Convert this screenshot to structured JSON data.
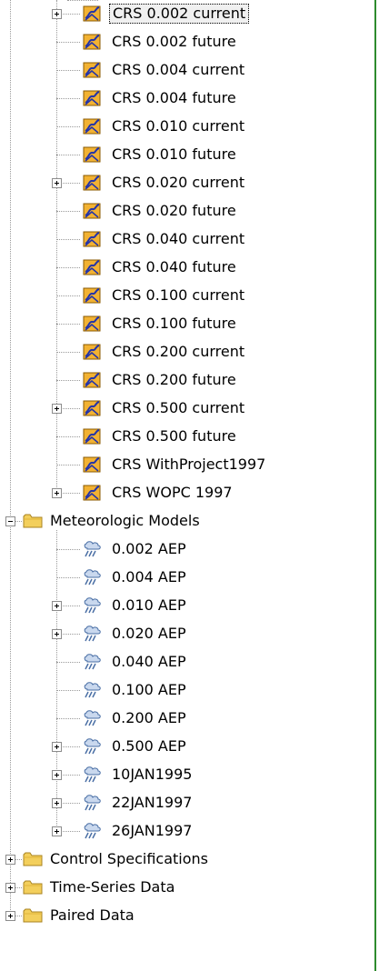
{
  "tree": {
    "basin_models_children": [
      {
        "label": "CRS 0.002 current",
        "expandable": true,
        "selected": true
      },
      {
        "label": "CRS 0.002 future",
        "expandable": false
      },
      {
        "label": "CRS 0.004 current",
        "expandable": false
      },
      {
        "label": "CRS 0.004 future",
        "expandable": false
      },
      {
        "label": "CRS 0.010 current",
        "expandable": false
      },
      {
        "label": "CRS 0.010 future",
        "expandable": false
      },
      {
        "label": "CRS 0.020 current",
        "expandable": true
      },
      {
        "label": "CRS 0.020 future",
        "expandable": false
      },
      {
        "label": "CRS 0.040 current",
        "expandable": false
      },
      {
        "label": "CRS 0.040 future",
        "expandable": false
      },
      {
        "label": "CRS 0.100 current",
        "expandable": false
      },
      {
        "label": "CRS 0.100 future",
        "expandable": false
      },
      {
        "label": "CRS 0.200 current",
        "expandable": false
      },
      {
        "label": "CRS 0.200 future",
        "expandable": false
      },
      {
        "label": "CRS 0.500 current",
        "expandable": true
      },
      {
        "label": "CRS 0.500 future",
        "expandable": false
      },
      {
        "label": "CRS WithProject1997",
        "expandable": false
      },
      {
        "label": "CRS WOPC 1997",
        "expandable": true
      }
    ],
    "meteorologic_models": {
      "label": "Meteorologic Models",
      "expanded": true,
      "children": [
        {
          "label": "0.002 AEP",
          "expandable": false
        },
        {
          "label": "0.004 AEP",
          "expandable": false
        },
        {
          "label": "0.010 AEP",
          "expandable": true
        },
        {
          "label": "0.020 AEP",
          "expandable": true
        },
        {
          "label": "0.040 AEP",
          "expandable": false
        },
        {
          "label": "0.100 AEP",
          "expandable": false
        },
        {
          "label": "0.200 AEP",
          "expandable": false
        },
        {
          "label": "0.500 AEP",
          "expandable": true
        },
        {
          "label": "10JAN1995",
          "expandable": true
        },
        {
          "label": "22JAN1997",
          "expandable": true
        },
        {
          "label": "26JAN1997",
          "expandable": true
        }
      ]
    },
    "root_folders": [
      {
        "label": "Control Specifications",
        "expandable": true
      },
      {
        "label": "Time-Series Data",
        "expandable": true
      },
      {
        "label": "Paired Data",
        "expandable": true
      }
    ]
  },
  "icons": {
    "basin": "basin-model-icon",
    "met": "meteorologic-model-icon",
    "folder": "folder-icon"
  },
  "colors": {
    "frame_border": "#2e8b2e",
    "folder_fill": "#f3cf5c",
    "basin_fill": "#f2b233",
    "basin_stroke": "#2233aa",
    "met_cloud": "#6a8fc0"
  }
}
